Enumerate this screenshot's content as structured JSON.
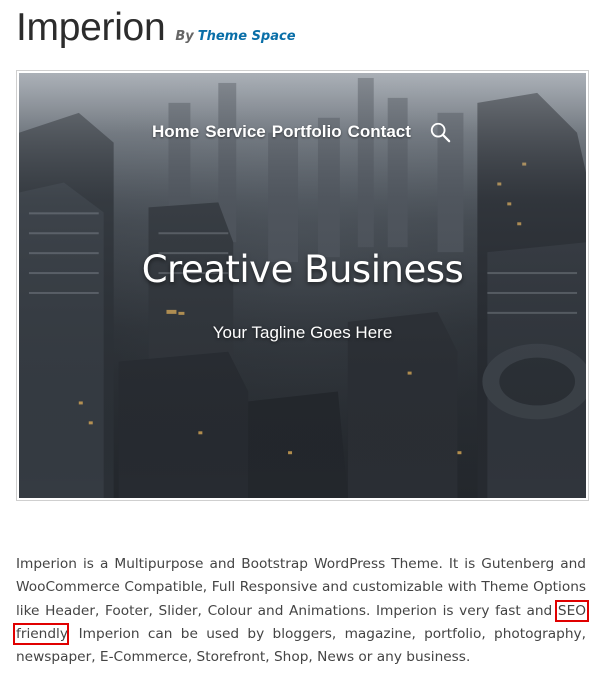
{
  "header": {
    "title": "Imperion",
    "by_label": "By",
    "author": "Theme Space"
  },
  "preview": {
    "nav": {
      "items": [
        {
          "label": "Home"
        },
        {
          "label": "Service"
        },
        {
          "label": "Portfolio"
        },
        {
          "label": "Contact"
        }
      ],
      "search_icon": "search-icon"
    },
    "hero_title": "Creative Business",
    "tagline": "Your Tagline Goes Here"
  },
  "description": {
    "text_before": "Imperion is a Multipurpose and Bootstrap WordPress Theme. It is Gutenberg and WooCommerce Compatible, Full Responsive and customizable with Theme Options like Header, Footer, Slider, Colour and Animations. Imperion is very fast and",
    "highlight": "SEO friendly",
    "text_after": ". Imperion can be used by bloggers, magazine, portfolio, photography, newspaper, E-Commerce, Storefront, Shop, News or any business."
  },
  "colors": {
    "author_link": "#0a6fa8",
    "highlight_box": "#e00000",
    "hero_text": "#ffffff"
  }
}
